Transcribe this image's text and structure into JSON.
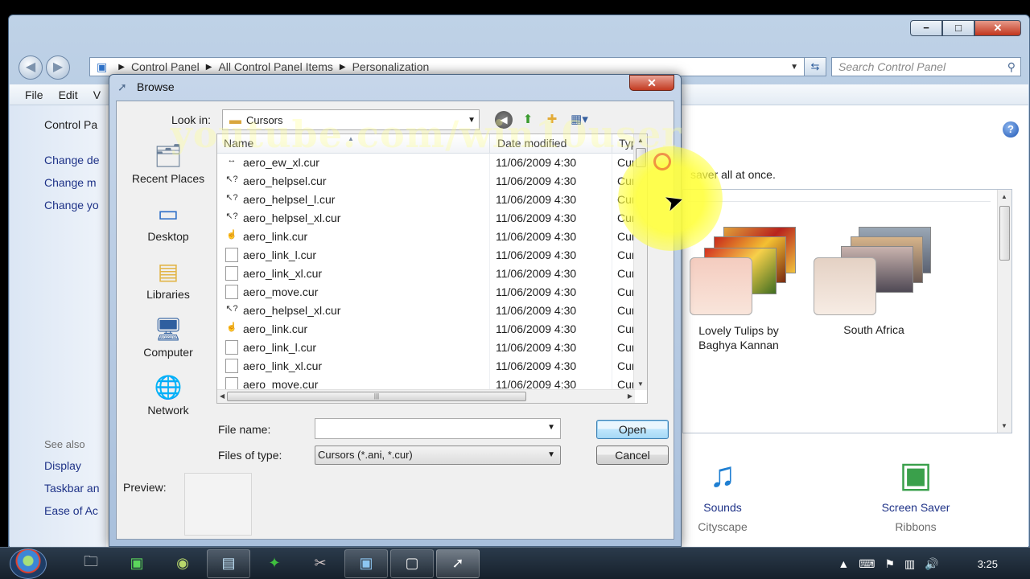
{
  "control_panel": {
    "breadcrumb": [
      "Control Panel",
      "All Control Panel Items",
      "Personalization"
    ],
    "search_placeholder": "Search Control Panel",
    "menu": [
      "File",
      "Edit",
      "V"
    ],
    "left_links": [
      "Control Pa",
      "Change de",
      "Change m",
      "Change yo"
    ],
    "see_also": "See also",
    "see_also_links": [
      "Display",
      "Taskbar an",
      "Ease of Ac"
    ],
    "description_fragment": "saver all at once.",
    "themes": [
      {
        "name": "Lovely Tulips by Baghya Kannan"
      },
      {
        "name": "South Africa"
      }
    ],
    "bottom_items": [
      {
        "title": "Sounds",
        "sub": "Cityscape",
        "icon": "music-notes-icon"
      },
      {
        "title": "Screen Saver",
        "sub": "Ribbons",
        "icon": "screen-saver-icon"
      }
    ]
  },
  "dialog": {
    "title": "Browse",
    "look_in_label": "Look in:",
    "look_in_value": "Cursors",
    "places": [
      "Recent Places",
      "Desktop",
      "Libraries",
      "Computer",
      "Network"
    ],
    "columns": {
      "name": "Name",
      "date": "Date modified",
      "type": "Type"
    },
    "files": [
      {
        "name": "aero_ew_xl.cur",
        "date": "11/06/2009 4:30",
        "type": "Cursor",
        "icon": "resize-icon"
      },
      {
        "name": "aero_helpsel.cur",
        "date": "11/06/2009 4:30",
        "type": "Cursor",
        "icon": "help-select-icon"
      },
      {
        "name": "aero_helpsel_l.cur",
        "date": "11/06/2009 4:30",
        "type": "Cursor",
        "icon": "help-select-icon"
      },
      {
        "name": "aero_helpsel_xl.cur",
        "date": "11/06/2009 4:30",
        "type": "Cursor",
        "icon": "help-select-icon"
      },
      {
        "name": "aero_link.cur",
        "date": "11/06/2009 4:30",
        "type": "Cursor",
        "icon": "hand-icon"
      },
      {
        "name": "aero_link_l.cur",
        "date": "11/06/2009 4:30",
        "type": "Cursor",
        "icon": "file-icon"
      },
      {
        "name": "aero_link_xl.cur",
        "date": "11/06/2009 4:30",
        "type": "Cursor",
        "icon": "file-icon"
      },
      {
        "name": "aero_move.cur",
        "date": "11/06/2009 4:30",
        "type": "Cursor",
        "icon": "file-icon"
      },
      {
        "name": "aero_helpsel_xl.cur",
        "date": "11/06/2009 4:30",
        "type": "Cursor",
        "icon": "help-select-icon"
      },
      {
        "name": "aero_link.cur",
        "date": "11/06/2009 4:30",
        "type": "Cursor",
        "icon": "hand-icon"
      },
      {
        "name": "aero_link_l.cur",
        "date": "11/06/2009 4:30",
        "type": "Cursor",
        "icon": "file-icon"
      },
      {
        "name": "aero_link_xl.cur",
        "date": "11/06/2009 4:30",
        "type": "Cursor",
        "icon": "file-icon"
      },
      {
        "name": "aero_move.cur",
        "date": "11/06/2009 4:30",
        "type": "Cursor",
        "icon": "file-icon"
      }
    ],
    "file_name_label": "File name:",
    "file_name_value": "",
    "file_type_label": "Files of type:",
    "file_type_value": "Cursors (*.ani, *.cur)",
    "open_label": "Open",
    "cancel_label": "Cancel",
    "preview_label": "Preview:"
  },
  "watermark": "youtube.com/win10user",
  "taskbar": {
    "clock": "3:25"
  }
}
